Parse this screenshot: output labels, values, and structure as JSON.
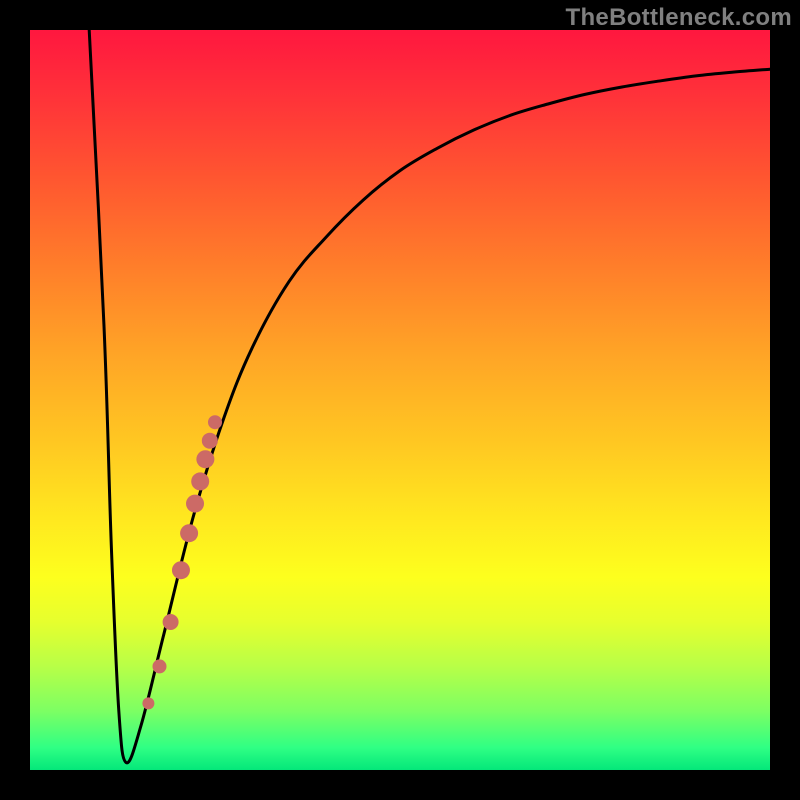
{
  "watermark": "TheBottleneck.com",
  "colors": {
    "curve_stroke": "#000000",
    "points_fill": "#cc6a66",
    "gradient_top": "#ff173f",
    "gradient_bottom": "#04e77a"
  },
  "chart_data": {
    "type": "line",
    "title": "",
    "xlabel": "",
    "ylabel": "",
    "xlim": [
      0,
      100
    ],
    "ylim": [
      0,
      100
    ],
    "series": [
      {
        "name": "bottleneck-curve",
        "x": [
          8,
          10,
          11,
          12,
          13,
          15,
          18,
          22,
          26,
          30,
          35,
          40,
          45,
          50,
          55,
          60,
          65,
          70,
          75,
          80,
          85,
          90,
          95,
          100
        ],
        "y": [
          100,
          60,
          30,
          8,
          1,
          6,
          18,
          34,
          47,
          57,
          66,
          72,
          77,
          81,
          84,
          86.5,
          88.5,
          90,
          91.3,
          92.3,
          93.1,
          93.8,
          94.3,
          94.7
        ]
      }
    ],
    "points": [
      {
        "x": 16.0,
        "y": 9.0,
        "r": 6
      },
      {
        "x": 17.5,
        "y": 14.0,
        "r": 7
      },
      {
        "x": 19.0,
        "y": 20.0,
        "r": 8
      },
      {
        "x": 20.4,
        "y": 27.0,
        "r": 9
      },
      {
        "x": 21.5,
        "y": 32.0,
        "r": 9
      },
      {
        "x": 22.3,
        "y": 36.0,
        "r": 9
      },
      {
        "x": 23.0,
        "y": 39.0,
        "r": 9
      },
      {
        "x": 23.7,
        "y": 42.0,
        "r": 9
      },
      {
        "x": 24.3,
        "y": 44.5,
        "r": 8
      },
      {
        "x": 25.0,
        "y": 47.0,
        "r": 7
      }
    ]
  }
}
